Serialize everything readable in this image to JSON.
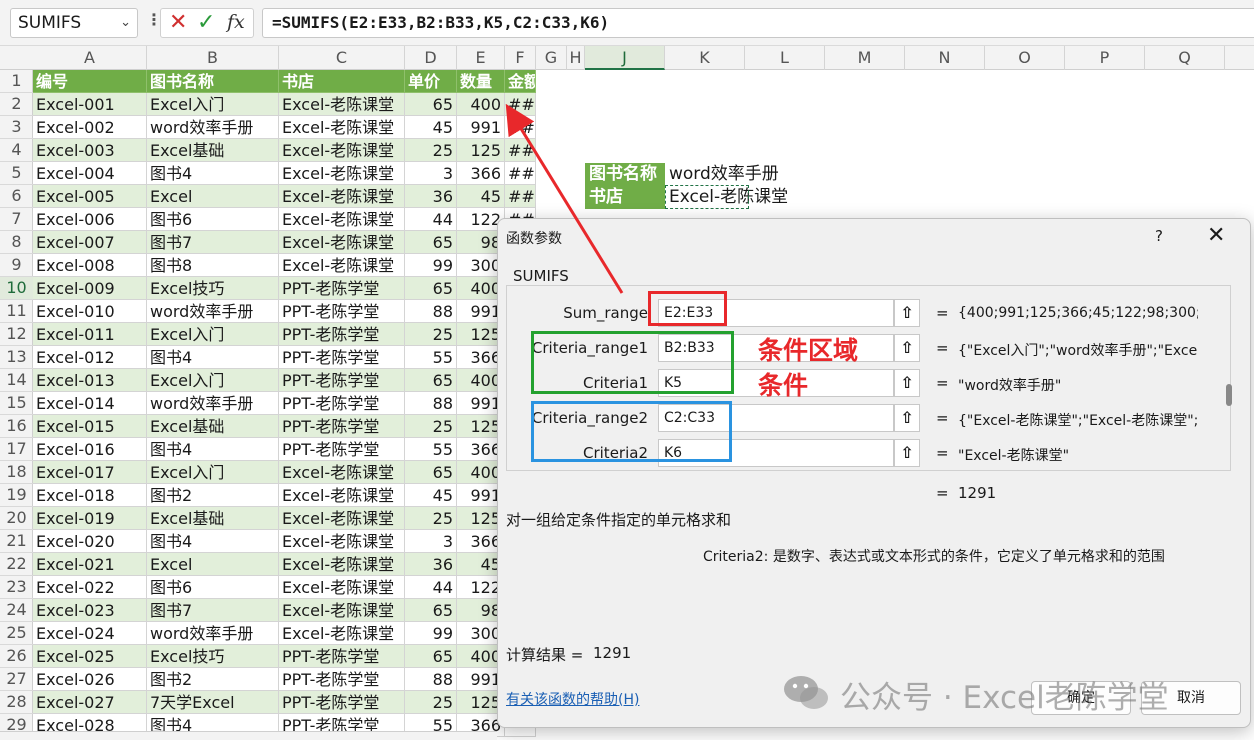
{
  "formula_bar": {
    "name_box": "SUMIFS",
    "name_box_chevron": "chevron-down-icon",
    "dots": "⋮",
    "cancel_icon": "✕",
    "confirm_icon": "✓",
    "fx_label": "fx",
    "formula": "=SUMIFS(E2:E33,B2:B33,K5,C2:C33,K6)"
  },
  "columns": [
    "A",
    "B",
    "C",
    "D",
    "E",
    "F",
    "G",
    "H",
    "J",
    "K",
    "L",
    "M",
    "N",
    "O",
    "P",
    "Q"
  ],
  "rows": [
    "1",
    "2",
    "3",
    "4",
    "5",
    "6",
    "7",
    "8",
    "9",
    "10",
    "11",
    "12",
    "13",
    "14",
    "15",
    "16",
    "17",
    "18",
    "19",
    "20",
    "21",
    "22",
    "23",
    "24",
    "25",
    "26",
    "27",
    "28",
    "29"
  ],
  "table": {
    "headers": [
      "编号",
      "图书名称",
      "书店",
      "单价",
      "数量",
      "金额"
    ],
    "data": [
      [
        "Excel-001",
        "Excel入门",
        "Excel-老陈课堂",
        "65",
        "400",
        "##"
      ],
      [
        "Excel-002",
        "word效率手册",
        "Excel-老陈课堂",
        "45",
        "991",
        "##"
      ],
      [
        "Excel-003",
        "Excel基础",
        "Excel-老陈课堂",
        "25",
        "125",
        "##"
      ],
      [
        "Excel-004",
        "图书4",
        "Excel-老陈课堂",
        "3",
        "366",
        "##"
      ],
      [
        "Excel-005",
        "Excel",
        "Excel-老陈课堂",
        "36",
        "45",
        "##"
      ],
      [
        "Excel-006",
        "图书6",
        "Excel-老陈课堂",
        "44",
        "122",
        "##"
      ],
      [
        "Excel-007",
        "图书7",
        "Excel-老陈课堂",
        "65",
        "98",
        ""
      ],
      [
        "Excel-008",
        "图书8",
        "Excel-老陈课堂",
        "99",
        "300",
        ""
      ],
      [
        "Excel-009",
        "Excel技巧",
        "PPT-老陈学堂",
        "65",
        "400",
        ""
      ],
      [
        "Excel-010",
        "word效率手册",
        "PPT-老陈学堂",
        "88",
        "991",
        ""
      ],
      [
        "Excel-011",
        "Excel入门",
        "PPT-老陈学堂",
        "25",
        "125",
        ""
      ],
      [
        "Excel-012",
        "图书4",
        "PPT-老陈学堂",
        "55",
        "366",
        ""
      ],
      [
        "Excel-013",
        "Excel入门",
        "PPT-老陈学堂",
        "65",
        "400",
        ""
      ],
      [
        "Excel-014",
        "word效率手册",
        "PPT-老陈学堂",
        "88",
        "991",
        ""
      ],
      [
        "Excel-015",
        "Excel基础",
        "PPT-老陈学堂",
        "25",
        "125",
        ""
      ],
      [
        "Excel-016",
        "图书4",
        "PPT-老陈学堂",
        "55",
        "366",
        ""
      ],
      [
        "Excel-017",
        "Excel入门",
        "Excel-老陈课堂",
        "65",
        "400",
        ""
      ],
      [
        "Excel-018",
        "图书2",
        "Excel-老陈课堂",
        "45",
        "991",
        ""
      ],
      [
        "Excel-019",
        "Excel基础",
        "Excel-老陈课堂",
        "25",
        "125",
        ""
      ],
      [
        "Excel-020",
        "图书4",
        "Excel-老陈课堂",
        "3",
        "366",
        ""
      ],
      [
        "Excel-021",
        "Excel",
        "Excel-老陈课堂",
        "36",
        "45",
        ""
      ],
      [
        "Excel-022",
        "图书6",
        "Excel-老陈课堂",
        "44",
        "122",
        ""
      ],
      [
        "Excel-023",
        "图书7",
        "Excel-老陈课堂",
        "65",
        "98",
        ""
      ],
      [
        "Excel-024",
        "word效率手册",
        "Excel-老陈课堂",
        "99",
        "300",
        ""
      ],
      [
        "Excel-025",
        "Excel技巧",
        "PPT-老陈学堂",
        "65",
        "400",
        ""
      ],
      [
        "Excel-026",
        "图书2",
        "PPT-老陈学堂",
        "88",
        "991",
        ""
      ],
      [
        "Excel-027",
        "7天学Excel",
        "PPT-老陈学堂",
        "25",
        "125",
        ""
      ],
      [
        "Excel-028",
        "图书4",
        "PPT-老陈学堂",
        "55",
        "366",
        ""
      ]
    ]
  },
  "criteria": {
    "label1": "图书名称",
    "value1": "word效率手册",
    "label2": "书店",
    "value2": "Excel-老陈课堂"
  },
  "dialog": {
    "title": "函数参数",
    "help_mark": "?",
    "close_mark": "✕",
    "function_name": "SUMIFS",
    "args": [
      {
        "label": "Sum_range",
        "value": "E2:E33",
        "result": "{400;991;125;366;45;122;98;300;400"
      },
      {
        "label": "Criteria_range1",
        "value": "B2:B33",
        "result": "{\"Excel入门\";\"word效率手册\";\"Excel基础\""
      },
      {
        "label": "Criteria1",
        "value": "K5",
        "result": "\"word效率手册\""
      },
      {
        "label": "Criteria_range2",
        "value": "C2:C33",
        "result": "{\"Excel-老陈课堂\";\"Excel-老陈课堂\";"
      },
      {
        "label": "Criteria2",
        "value": "K6",
        "result": "\"Excel-老陈课堂\""
      }
    ],
    "collapse_icon": "⇧",
    "equals": "=",
    "total": "1291",
    "description": "对一组给定条件指定的单元格求和",
    "param_help": "Criteria2:   是数字、表达式或文本形式的条件，它定义了单元格求和的范围",
    "result_label": "计算结果 =",
    "result_value": "1291",
    "help_link": "有关该函数的帮助(H)",
    "ok": "确定",
    "cancel": "取消"
  },
  "annotations": {
    "criteria_range_label": "条件区域",
    "criteria_label": "条件",
    "sum_color": "#e8282b",
    "group1_color": "#23a12f",
    "group2_color": "#2a93e0"
  },
  "watermark": "公众号 · Excel老陈学堂"
}
